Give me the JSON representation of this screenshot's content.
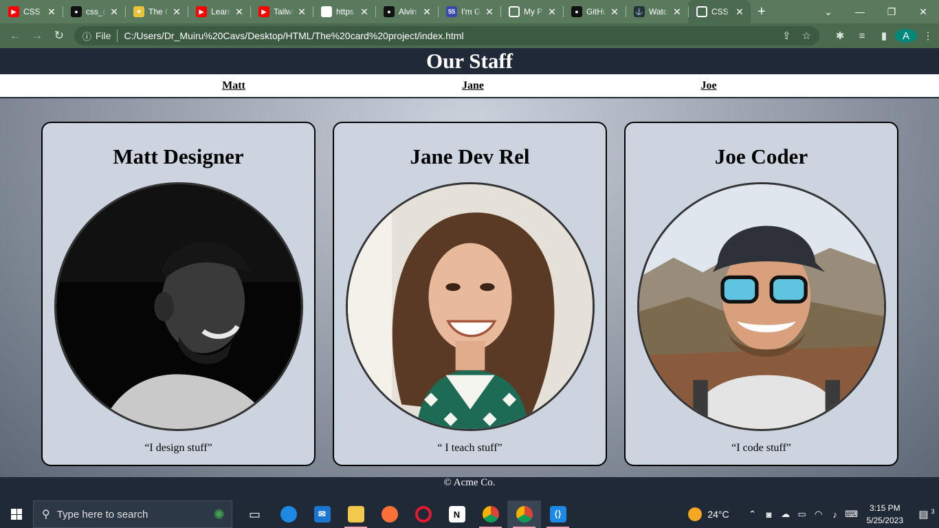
{
  "browser": {
    "tabs": [
      {
        "label": "CSS T",
        "icon": "youtube-icon"
      },
      {
        "label": "css_c",
        "icon": "github-icon"
      },
      {
        "label": "The C",
        "icon": "bard-icon"
      },
      {
        "label": "Learn",
        "icon": "youtube-icon"
      },
      {
        "label": "Tailwi",
        "icon": "youtube-icon"
      },
      {
        "label": "https",
        "icon": "chatgpt-icon"
      },
      {
        "label": "Alvin",
        "icon": "github-icon"
      },
      {
        "label": "I'm G",
        "icon": "site-55-icon"
      },
      {
        "label": "My P",
        "icon": "globe-icon"
      },
      {
        "label": "GitHu",
        "icon": "github-icon"
      },
      {
        "label": "Watc",
        "icon": "anchor-icon"
      },
      {
        "label": "CSS t",
        "icon": "globe-icon",
        "active": true
      }
    ],
    "scheme": "File",
    "url": "C:/Users/Dr_Muiru%20Cavs/Desktop/HTML/The%20card%20project/index.html",
    "profile_initial": "A"
  },
  "page": {
    "title": "Our Staff",
    "nav": [
      "Matt",
      "Jane",
      "Joe"
    ],
    "cards": [
      {
        "name": "Matt Designer",
        "quote": "“I design stuff”"
      },
      {
        "name": "Jane Dev Rel",
        "quote": "“ I teach stuff”"
      },
      {
        "name": "Joe Coder",
        "quote": "“I code stuff”"
      }
    ],
    "footer": "© Acme Co."
  },
  "taskbar": {
    "search_placeholder": "Type here to search",
    "weather": "24°C",
    "time": "3:15 PM",
    "date": "5/25/2023",
    "notifications": "3"
  }
}
